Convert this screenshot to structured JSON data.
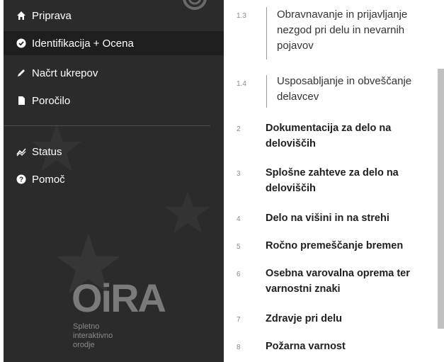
{
  "sidebar": {
    "nav": [
      {
        "label": "Priprava",
        "icon": "home-icon"
      },
      {
        "label": "Identifikacija + Ocena",
        "icon": "check-circle-icon"
      },
      {
        "label": "Načrt ukrepov",
        "icon": "pencil-icon"
      },
      {
        "label": "Poročilo",
        "icon": "document-icon"
      },
      {
        "label": "Status",
        "icon": "trend-icon"
      },
      {
        "label": "Pomoč",
        "icon": "help-icon"
      }
    ],
    "logo": "OiRA",
    "tagline": [
      "Spletno",
      "interaktivno",
      "orodje"
    ]
  },
  "content": {
    "items": [
      {
        "num": "1.3",
        "label": "Obravnavanje in prijavljanje nezgod pri delu in nevarnih pojavov",
        "sub": true
      },
      {
        "num": "1.4",
        "label": "Usposabljanje in obveščanje delavcev",
        "sub": true
      },
      {
        "num": "2",
        "label": "Dokumentacija za delo na deloviščih",
        "sub": false
      },
      {
        "num": "3",
        "label": "Splošne zahteve za delo na deloviščih",
        "sub": false
      },
      {
        "num": "4",
        "label": "Delo na višini in na strehi",
        "sub": false
      },
      {
        "num": "5",
        "label": "Ročno premeščanje bremen",
        "sub": false
      },
      {
        "num": "6",
        "label": "Osebna varovalna oprema ter varnostni znaki",
        "sub": false
      },
      {
        "num": "7",
        "label": "Zdravje pri delu",
        "sub": false
      },
      {
        "num": "8",
        "label": "Požarna varnost",
        "sub": false
      }
    ]
  }
}
